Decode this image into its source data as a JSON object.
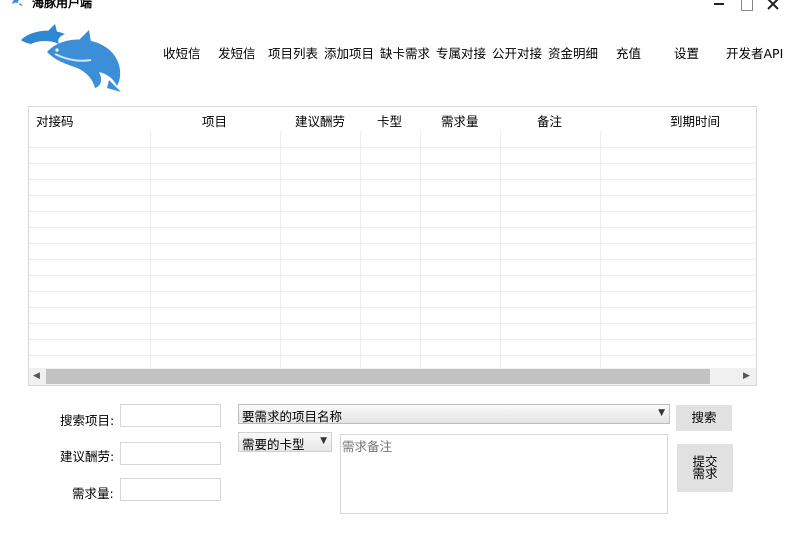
{
  "window": {
    "title": "海豚用户端",
    "controls": {
      "minimize": "minimize-icon",
      "maximize": "maximize-icon",
      "close": "close-icon"
    }
  },
  "logo": {
    "icon": "dolphin-logo"
  },
  "menu": {
    "items": [
      {
        "label": "收短信"
      },
      {
        "label": "发短信"
      },
      {
        "label": "项目列表"
      },
      {
        "label": "添加项目"
      },
      {
        "label": "缺卡需求"
      },
      {
        "label": "专属对接"
      },
      {
        "label": "公开对接"
      },
      {
        "label": "资金明细"
      },
      {
        "label": "充值"
      },
      {
        "label": "设置"
      },
      {
        "label": "开发者API"
      }
    ]
  },
  "grid": {
    "columns": [
      "对接码",
      "项目",
      "建议酬劳",
      "卡型",
      "需求量",
      "备注",
      "到期时间"
    ],
    "rows": []
  },
  "form": {
    "search_label": "搜索项目:",
    "reward_label": "建议酬劳:",
    "quantity_label": "需求量:",
    "search_value": "",
    "reward_value": "",
    "quantity_value": "",
    "project_combo_value": "要需求的项目名称",
    "card_type_value": "需要的卡型",
    "remark_placeholder": "需求备注",
    "search_button": "搜索",
    "submit_button_line1": "提交",
    "submit_button_line2": "需求"
  },
  "colors": {
    "button_bg": "#e1e1e1",
    "scroll_thumb": "#c2c2c2",
    "logo_blue": "#3c8fd6"
  }
}
